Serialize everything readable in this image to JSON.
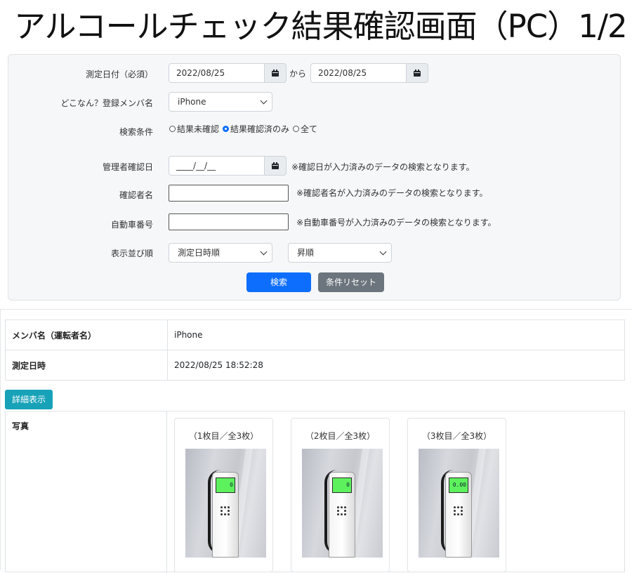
{
  "page_title": "アルコールチェック結果確認画面（PC）1/2",
  "search": {
    "date_label": "測定日付（必須）",
    "date_from": "2022/08/25",
    "date_sep": "から",
    "date_to": "2022/08/25",
    "member_label": "どこなん？登録メンバ名",
    "member_value": "iPhone",
    "condition_label": "検索条件",
    "condition_options": [
      "結果未確認",
      "結果確認済のみ",
      "全て"
    ],
    "condition_selected": "結果確認済のみ",
    "admin_date_label": "管理者確認日",
    "admin_date_placeholder": "____/__/__",
    "admin_date_note": "※確認日が入力済みのデータの検索となります。",
    "confirmer_label": "確認者名",
    "confirmer_note": "※確認者名が入力済みのデータの検索となります。",
    "car_label": "自動車番号",
    "car_note": "※自動車番号が入力済みのデータの検索となります。",
    "sort_label": "表示並び順",
    "sort_field": "測定日時順",
    "sort_order": "昇順",
    "search_button": "検索",
    "reset_button": "条件リセット"
  },
  "result": {
    "member_header": "メンバ名（運転者名）",
    "member_value": "iPhone",
    "datetime_header": "測定日時",
    "datetime_value": "2022/08/25 18:52:28",
    "detail_button": "詳細表示",
    "photo_header": "写真",
    "photos": [
      {
        "caption": "（1枚目／全3枚）",
        "screen": "0"
      },
      {
        "caption": "（2枚目／全3枚）",
        "screen": "0"
      },
      {
        "caption": "（3枚目／全3枚）",
        "screen": "0.00"
      }
    ]
  },
  "colors": {
    "primary": "#0d6efd",
    "secondary": "#6c757d",
    "info": "#17a2b8"
  }
}
